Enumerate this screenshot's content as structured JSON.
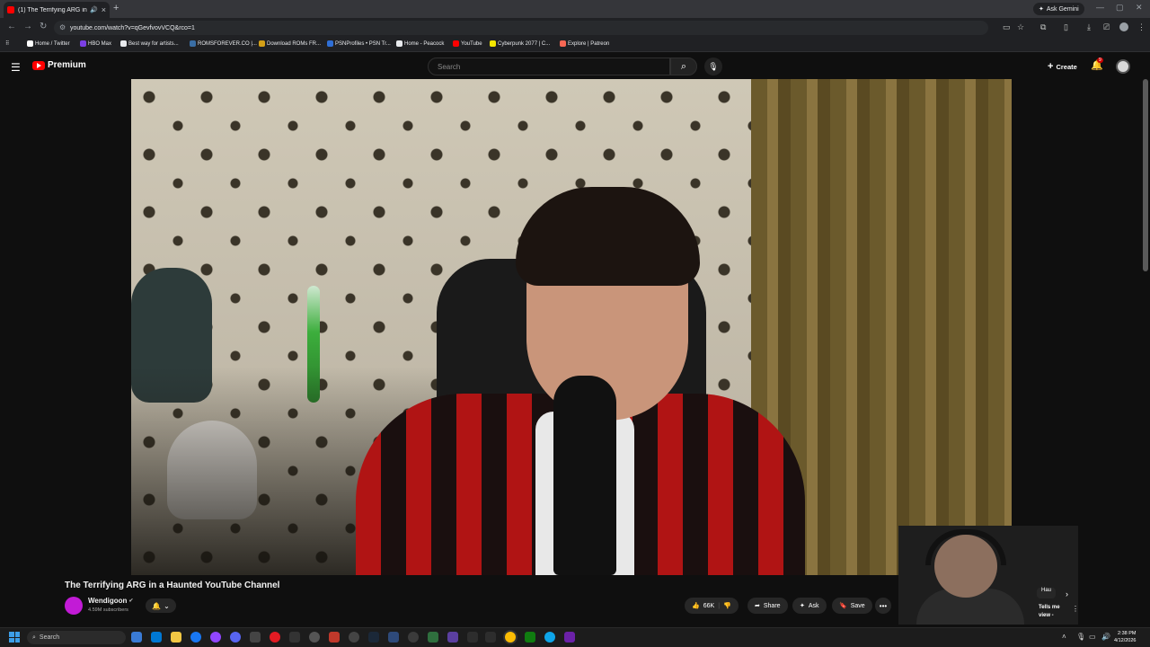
{
  "browser": {
    "tab_title": "(1) The Terrifying ARG in a H",
    "tab_close": "×",
    "new_tab": "+",
    "ask_gemini": "Ask Gemini",
    "url": "youtube.com/watch?v=qGevfvovVCQ&rco=1",
    "bookmarks": [
      {
        "label": "Home / Twitter",
        "color": "#ffffff"
      },
      {
        "label": "HBO Max",
        "color": "#7b3fe4"
      },
      {
        "label": "Best way for artists...",
        "color": "#e8eaed"
      },
      {
        "label": "ROMSFOREVER.CO |...",
        "color": "#3a6ea5"
      },
      {
        "label": "Download ROMs FR...",
        "color": "#d4a017"
      },
      {
        "label": "PSNProfiles • PSN Tr...",
        "color": "#2f6fd6"
      },
      {
        "label": "Home - Peacock",
        "color": "#e8eaed"
      },
      {
        "label": "YouTube",
        "color": "#ff0000"
      },
      {
        "label": "Cyberpunk 2077 | C...",
        "color": "#f3e600"
      },
      {
        "label": "Explore | Patreon",
        "color": "#f96854"
      }
    ]
  },
  "youtube": {
    "logo_text": "Premium",
    "search_placeholder": "Search",
    "create_label": "Create",
    "notif_count": "9",
    "video": {
      "title": "The Terrifying ARG in a Haunted YouTube Channel",
      "channel": "Wendigoon",
      "subscribers": "4.59M subscribers",
      "likes": "66K",
      "share": "Share",
      "ask": "Ask",
      "save": "Save"
    },
    "sidebar": {
      "chip": "Hau",
      "rec_line1": "Tells me",
      "rec_line2": "view -"
    }
  },
  "taskbar": {
    "search": "Search",
    "time": "2:38 PM",
    "date": "4/12/2026"
  },
  "colors": {
    "accent": "#ff0000",
    "channel_avatar": "#c21bd6"
  }
}
